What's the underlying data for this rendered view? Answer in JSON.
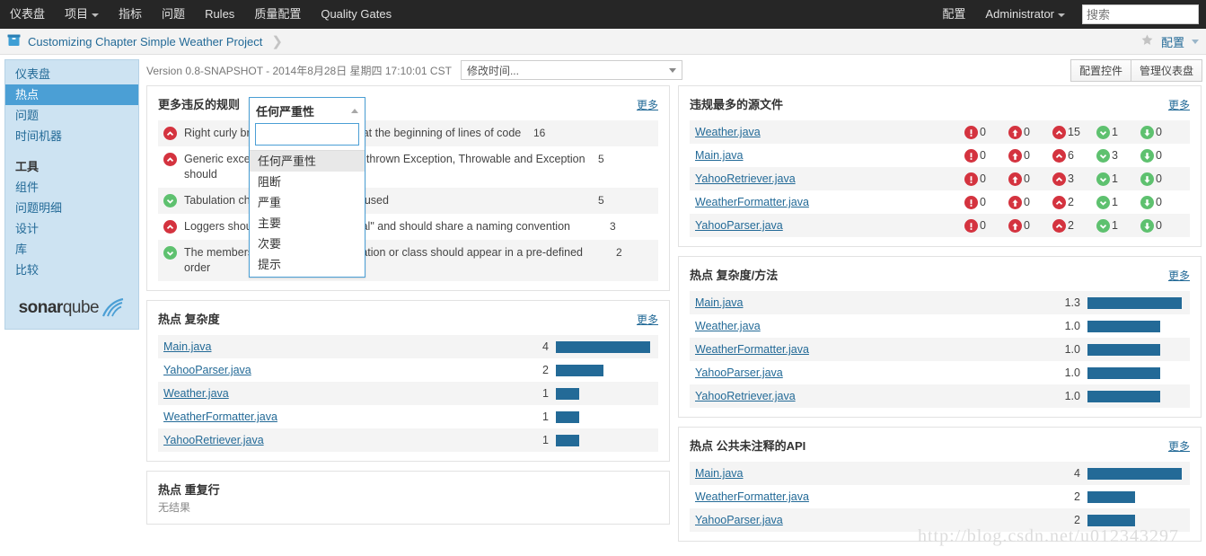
{
  "topnav": {
    "items": [
      {
        "label": "仪表盘",
        "caret": false
      },
      {
        "label": "项目",
        "caret": true
      },
      {
        "label": "指标",
        "caret": false
      },
      {
        "label": "问题",
        "caret": false
      },
      {
        "label": "Rules",
        "caret": false
      },
      {
        "label": "质量配置",
        "caret": false
      },
      {
        "label": "Quality Gates",
        "caret": false
      }
    ],
    "settings_label": "配置",
    "user_label": "Administrator",
    "search_placeholder": "搜索",
    "search_value": ""
  },
  "breadcrumb": {
    "project": "Customizing Chapter Simple Weather Project",
    "separator": "❯",
    "config_label": "配置",
    "star_icon": "star-icon",
    "project_icon": "project-box-icon"
  },
  "sidebar": {
    "items": [
      {
        "label": "仪表盘",
        "active": false
      },
      {
        "label": "热点",
        "active": true
      },
      {
        "label": "问题",
        "active": false
      },
      {
        "label": "时间机器",
        "active": false
      }
    ],
    "tools_heading": "工具",
    "tools": [
      {
        "label": "组件"
      },
      {
        "label": "问题明细"
      },
      {
        "label": "设计"
      },
      {
        "label": "库"
      },
      {
        "label": "比较"
      }
    ],
    "logo": {
      "bold": "sonar",
      "light": "qube"
    }
  },
  "toolbar": {
    "version_text": "Version 0.8-SNAPSHOT - 2014年8月28日 星期四 17:10:01 CST",
    "period_selected": "修改时间...",
    "config_widgets_label": "配置控件",
    "manage_dashboard_label": "管理仪表盘"
  },
  "severity_dropdown": {
    "header": "任何严重性",
    "input_value": "",
    "options": [
      {
        "label": "任何严重性",
        "selected": true
      },
      {
        "label": "阻断",
        "selected": false
      },
      {
        "label": "严重",
        "selected": false
      },
      {
        "label": "主要",
        "selected": false
      },
      {
        "label": "次要",
        "selected": false
      },
      {
        "label": "提示",
        "selected": false
      }
    ]
  },
  "widgets": {
    "most_violated_rules": {
      "title": "更多违反的规则",
      "more": "更多",
      "max_value": 16,
      "rows": [
        {
          "severity": "major",
          "text": "Right curly brace should be located at the beginning of lines of code",
          "value": 16
        },
        {
          "severity": "major",
          "text": "Generic exceptions should never be thrown Exception, Throwable and Exception should",
          "value": 5
        },
        {
          "severity": "minor",
          "text": "Tabulation characters should not be used",
          "value": 5
        },
        {
          "severity": "major",
          "text": "Loggers should be \"private static final\" and should share a naming convention",
          "value": 3
        },
        {
          "severity": "minor",
          "text": "The members of an interface declaration or class should appear in a pre-defined order",
          "value": 2
        }
      ]
    },
    "hotspot_complexity": {
      "title": "热点 复杂度",
      "more": "更多",
      "max_value": 4,
      "rows": [
        {
          "file": "Main.java",
          "value": "4",
          "num": 4
        },
        {
          "file": "YahooParser.java",
          "value": "2",
          "num": 2
        },
        {
          "file": "Weather.java",
          "value": "1",
          "num": 1
        },
        {
          "file": "WeatherFormatter.java",
          "value": "1",
          "num": 1
        },
        {
          "file": "YahooRetriever.java",
          "value": "1",
          "num": 1
        }
      ]
    },
    "hotspot_duplicated_lines": {
      "title": "热点 重复行",
      "empty_text": "无结果"
    },
    "most_violated_files": {
      "title": "违规最多的源文件",
      "more": "更多",
      "columns": [
        "blocker",
        "critical",
        "major",
        "minor",
        "info"
      ],
      "rows": [
        {
          "file": "Weather.java",
          "counts": [
            "0",
            "0",
            "15",
            "1",
            "0"
          ]
        },
        {
          "file": "Main.java",
          "counts": [
            "0",
            "0",
            "6",
            "3",
            "0"
          ]
        },
        {
          "file": "YahooRetriever.java",
          "counts": [
            "0",
            "0",
            "3",
            "1",
            "0"
          ]
        },
        {
          "file": "WeatherFormatter.java",
          "counts": [
            "0",
            "0",
            "2",
            "1",
            "0"
          ]
        },
        {
          "file": "YahooParser.java",
          "counts": [
            "0",
            "0",
            "2",
            "1",
            "0"
          ]
        }
      ]
    },
    "hotspot_complexity_per_method": {
      "title": "热点 复杂度/方法",
      "more": "更多",
      "max_value": 1.3,
      "rows": [
        {
          "file": "Main.java",
          "value": "1.3",
          "num": 1.3
        },
        {
          "file": "Weather.java",
          "value": "1.0",
          "num": 1.0
        },
        {
          "file": "WeatherFormatter.java",
          "value": "1.0",
          "num": 1.0
        },
        {
          "file": "YahooParser.java",
          "value": "1.0",
          "num": 1.0
        },
        {
          "file": "YahooRetriever.java",
          "value": "1.0",
          "num": 1.0
        }
      ]
    },
    "hotspot_public_undocumented_api": {
      "title": "热点 公共未注释的API",
      "more": "更多",
      "max_value": 4,
      "rows": [
        {
          "file": "Main.java",
          "value": "4",
          "num": 4
        },
        {
          "file": "WeatherFormatter.java",
          "value": "2",
          "num": 2
        },
        {
          "file": "YahooParser.java",
          "value": "2",
          "num": 2
        }
      ]
    }
  },
  "watermark": "http://blog.csdn.net/u012343297",
  "colors": {
    "accent": "#236a97",
    "bar": "#236a97",
    "severity_red": "#d4333f",
    "severity_green": "#5ec16f",
    "active_sidebar": "#4b9fd5"
  }
}
